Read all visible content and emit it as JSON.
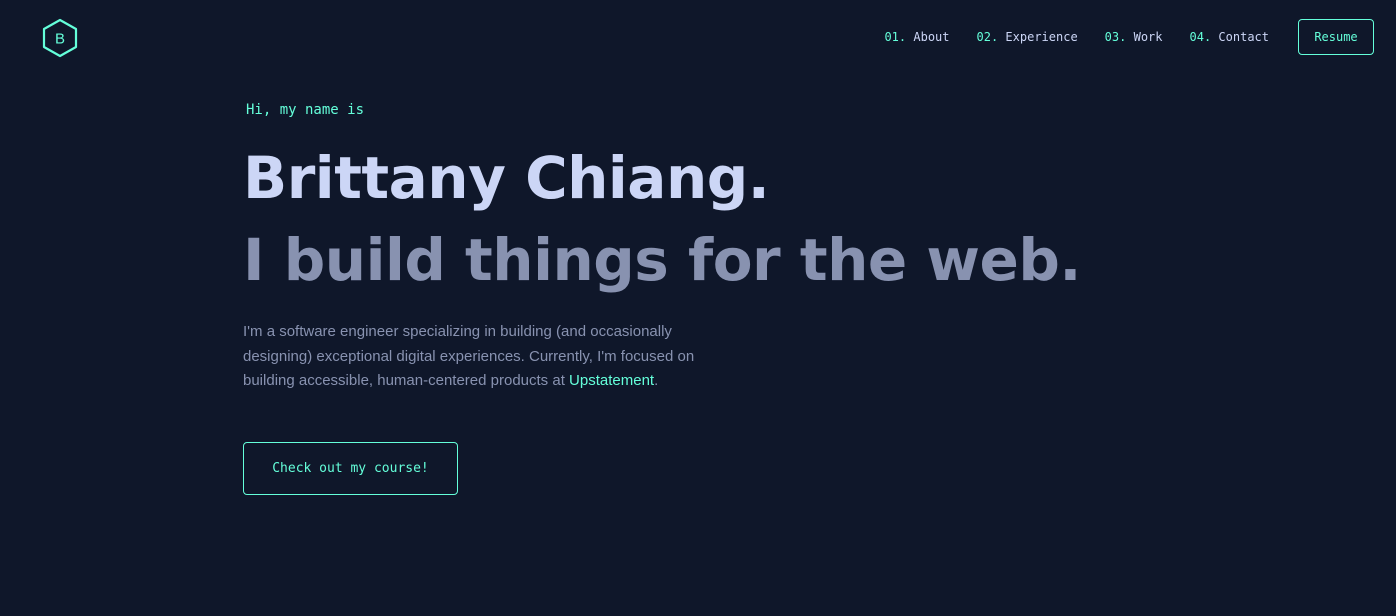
{
  "colors": {
    "background": "#0f172a",
    "accent": "#64ffda",
    "heading": "#ccd6f6",
    "body": "#8892b0"
  },
  "logo": {
    "icon": "hexagon-logo-icon",
    "letter": "B"
  },
  "nav": {
    "items": [
      {
        "num": "01.",
        "label": "About"
      },
      {
        "num": "02.",
        "label": "Experience"
      },
      {
        "num": "03.",
        "label": "Work"
      },
      {
        "num": "04.",
        "label": "Contact"
      }
    ],
    "resume_label": "Resume"
  },
  "hero": {
    "greeting": "Hi, my name is",
    "name": "Brittany Chiang.",
    "tagline": "I build things for the web.",
    "bio_text": "I'm a software engineer specializing in building (and occasionally designing) exceptional digital experiences. Currently, I'm focused on building accessible, human-centered products at ",
    "bio_link": "Upstatement",
    "bio_end": ".",
    "cta_label": "Check out my course!"
  }
}
